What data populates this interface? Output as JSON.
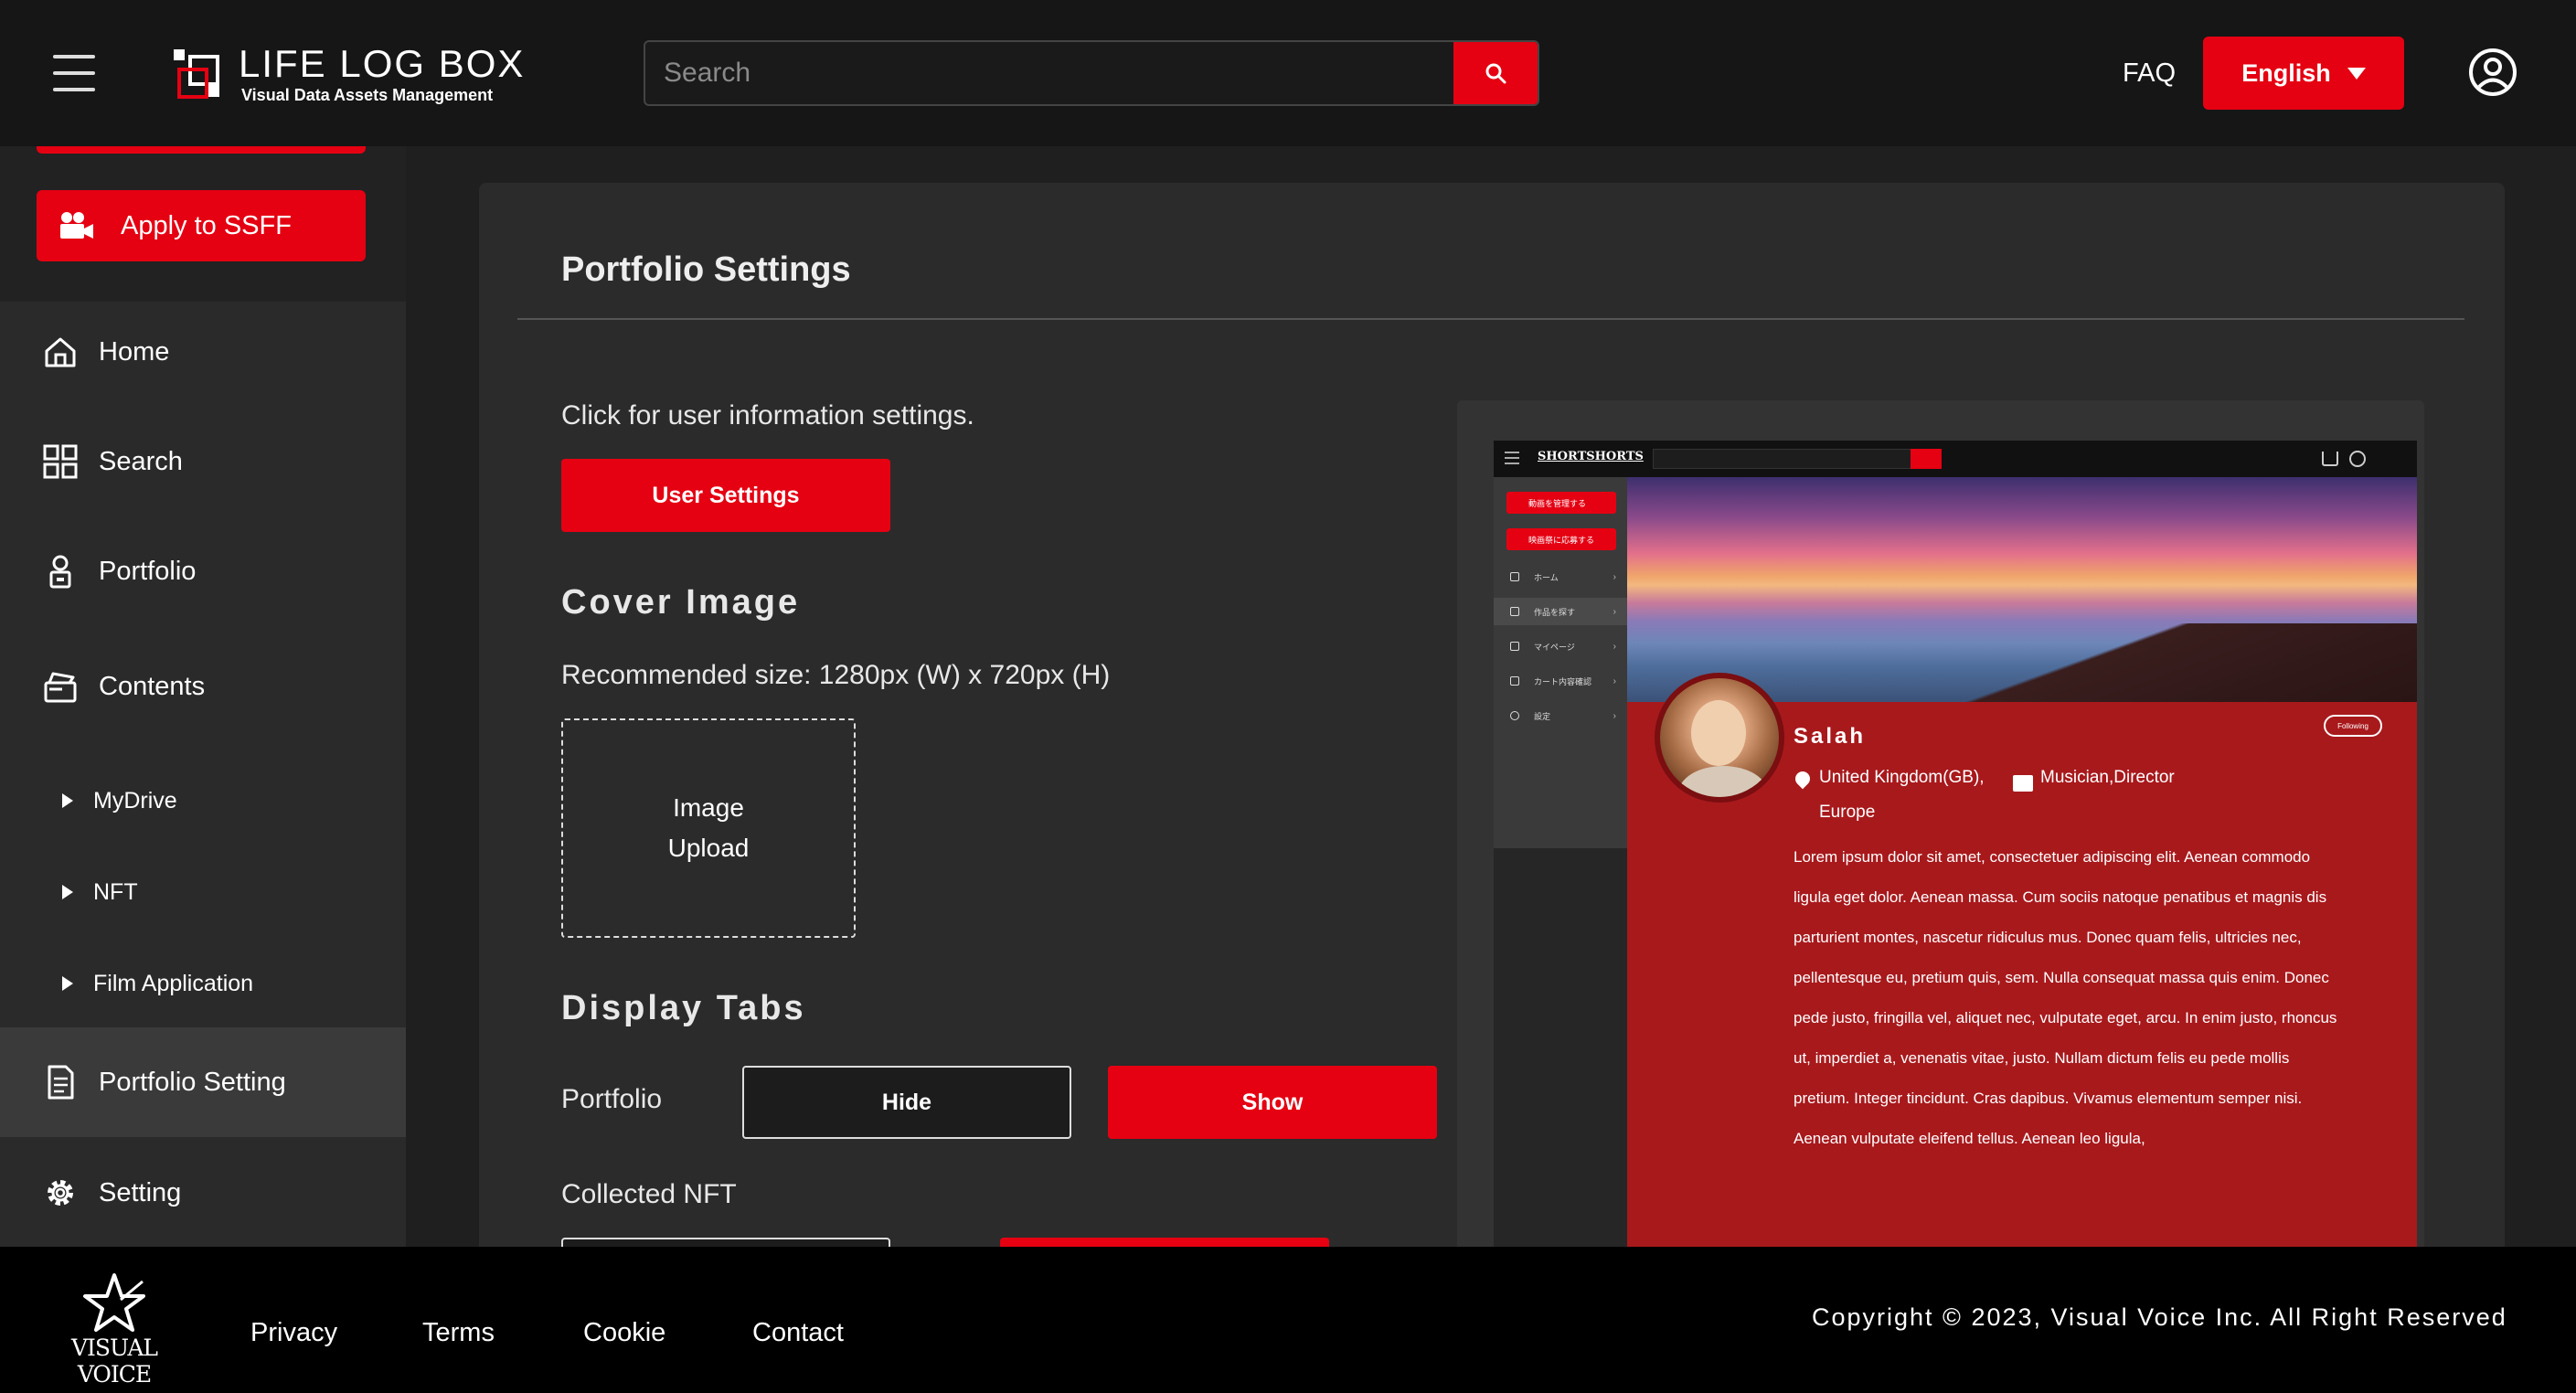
{
  "header": {
    "logo_title": "LIFE LOG BOX",
    "logo_subtitle": "Visual Data Assets Management",
    "search_placeholder": "Search",
    "faq_label": "FAQ",
    "language_label": "English"
  },
  "sidebar": {
    "apply_label": "Apply to SSFF",
    "items": [
      {
        "label": "Home",
        "icon": "home-icon"
      },
      {
        "label": "Search",
        "icon": "grid-icon"
      },
      {
        "label": "Portfolio",
        "icon": "portfolio-icon"
      },
      {
        "label": "Contents",
        "icon": "contents-icon"
      }
    ],
    "sub_items": [
      {
        "label": "MyDrive"
      },
      {
        "label": "NFT"
      },
      {
        "label": "Film Application"
      }
    ],
    "bottom_items": [
      {
        "label": "Portfolio Setting",
        "icon": "document-icon",
        "active": true
      },
      {
        "label": "Setting",
        "icon": "gear-icon"
      }
    ]
  },
  "main": {
    "title": "Portfolio Settings",
    "click_text": "Click for user information settings.",
    "user_settings_label": "User Settings",
    "cover_heading": "Cover Image",
    "recommended_size": "Recommended size: 1280px (W) x 720px (H)",
    "upload_line1": "Image",
    "upload_line2": "Upload",
    "display_tabs_heading": "Display Tabs",
    "tabs": [
      {
        "label": "Portfolio",
        "hide_label": "Hide",
        "show_label": "Show",
        "state": "Show"
      },
      {
        "label": "Collected NFT",
        "hide_label": "",
        "show_label": "",
        "state": "Show"
      }
    ]
  },
  "preview": {
    "logo": "SHORTSHORTS",
    "side_buttons": [
      "動画を管理する",
      "映画祭に応募する"
    ],
    "side_nav": [
      "ホーム",
      "作品を探す",
      "マイページ",
      "カート内容確認",
      "設定"
    ],
    "name": "Salah",
    "follow_label": "Following",
    "location_line1": "United Kingdom(GB),",
    "location_line2": "Europe",
    "role": "Musician,Director",
    "bio": "Lorem ipsum dolor sit amet, consectetuer adipiscing elit. Aenean commodo ligula eget dolor. Aenean massa. Cum sociis natoque penatibus et magnis dis parturient montes, nascetur ridiculus mus. Donec quam felis, ultricies nec, pellentesque eu, pretium quis, sem. Nulla consequat massa quis enim. Donec pede justo, fringilla vel, aliquet nec, vulputate eget, arcu. In enim justo, rhoncus ut, imperdiet a, venenatis vitae, justo. Nullam dictum felis eu pede mollis pretium. Integer tincidunt. Cras dapibus. Vivamus elementum semper nisi. Aenean vulputate eleifend tellus. Aenean leo ligula,"
  },
  "footer": {
    "brand": "VISUAL VOICE",
    "links": [
      "Privacy",
      "Terms",
      "Cookie",
      "Contact"
    ],
    "copyright": "Copyright © 2023, Visual Voice Inc. All Right Reserved"
  },
  "colors": {
    "accent": "#e50012",
    "header_bg": "#161616",
    "sidebar_bg": "#2a2a2a",
    "card_bg": "#2b2b2b",
    "profile_red": "#a8191c"
  }
}
